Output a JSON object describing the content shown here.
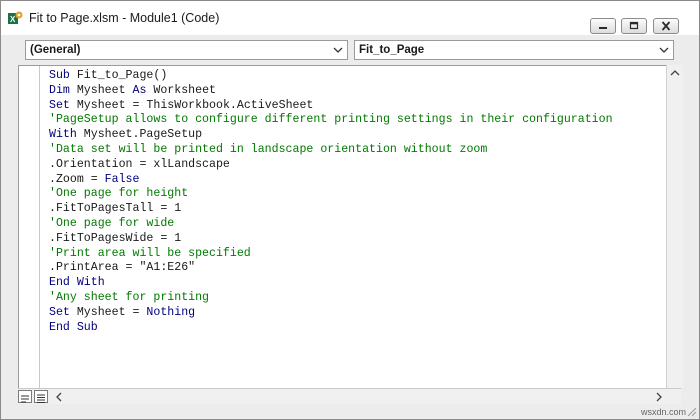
{
  "window": {
    "title": "Fit to Page.xlsm - Module1 (Code)",
    "icon": "excel-macro-icon",
    "controls": [
      "minimize-icon",
      "restore-icon",
      "close-icon"
    ]
  },
  "combos": {
    "object": "(General)",
    "procedure": "Fit_to_Page"
  },
  "code": {
    "lines": [
      [
        {
          "t": "kw",
          "s": "Sub "
        },
        {
          "t": "txt",
          "s": "Fit_to_Page()"
        }
      ],
      [
        {
          "t": "kw",
          "s": "Dim "
        },
        {
          "t": "txt",
          "s": "Mysheet "
        },
        {
          "t": "kw",
          "s": "As "
        },
        {
          "t": "txt",
          "s": "Worksheet"
        }
      ],
      [
        {
          "t": "kw",
          "s": "Set "
        },
        {
          "t": "txt",
          "s": "Mysheet = ThisWorkbook.ActiveSheet"
        }
      ],
      [
        {
          "t": "cm",
          "s": "'PageSetup allows to configure different printing settings in their configuration"
        }
      ],
      [
        {
          "t": "kw",
          "s": "With "
        },
        {
          "t": "txt",
          "s": "Mysheet.PageSetup"
        }
      ],
      [
        {
          "t": "cm",
          "s": "'Data set will be printed in landscape orientation without zoom"
        }
      ],
      [
        {
          "t": "txt",
          "s": ".Orientation = xlLandscape"
        }
      ],
      [
        {
          "t": "txt",
          "s": ".Zoom = "
        },
        {
          "t": "kw",
          "s": "False"
        }
      ],
      [
        {
          "t": "cm",
          "s": "'One page for height"
        }
      ],
      [
        {
          "t": "txt",
          "s": ".FitToPagesTall = 1"
        }
      ],
      [
        {
          "t": "cm",
          "s": "'One page for wide"
        }
      ],
      [
        {
          "t": "txt",
          "s": ".FitToPagesWide = 1"
        }
      ],
      [
        {
          "t": "cm",
          "s": "'Print area will be specified"
        }
      ],
      [
        {
          "t": "txt",
          "s": ".PrintArea = \"A1:E26\""
        }
      ],
      [
        {
          "t": "kw",
          "s": "End With"
        }
      ],
      [
        {
          "t": "cm",
          "s": "'Any sheet for printing"
        }
      ],
      [
        {
          "t": "kw",
          "s": "Set "
        },
        {
          "t": "txt",
          "s": "Mysheet = "
        },
        {
          "t": "kw",
          "s": "Nothing"
        }
      ],
      [
        {
          "t": "kw",
          "s": "End Sub"
        }
      ]
    ]
  },
  "watermark": "wsxdn.com",
  "colors": {
    "keyword": "#00007f",
    "comment": "#007a00",
    "text": "#1a1a1a"
  }
}
